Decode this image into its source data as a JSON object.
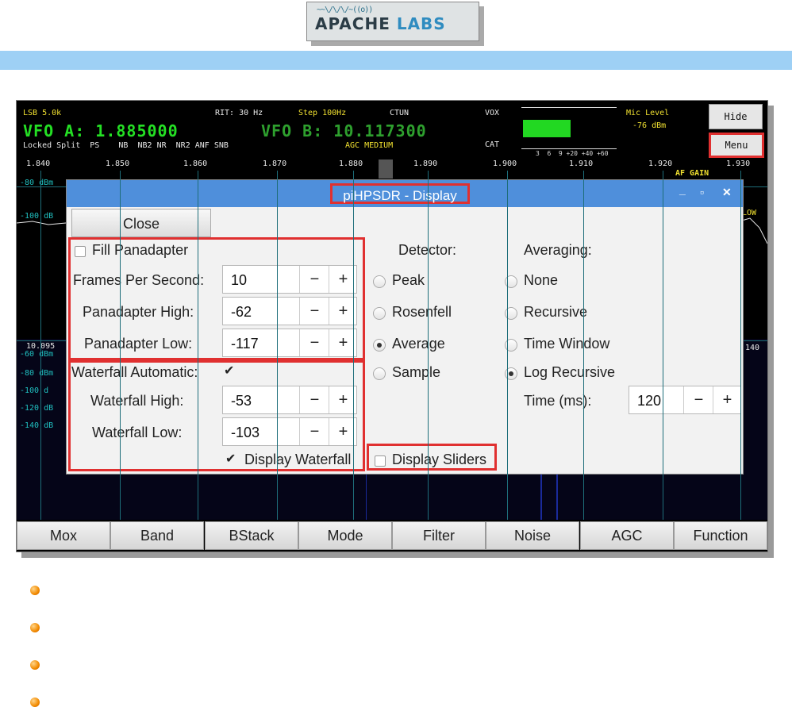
{
  "logo": {
    "wave": "~~\\/\\/\\/~((o))",
    "main": "APACHE",
    "sub": "LABS"
  },
  "radio": {
    "mode": "LSB 5.0k",
    "rit": "RIT: 30 Hz",
    "step": "Step 100Hz",
    "ctun": "CTUN",
    "vox": "VOX",
    "cat": "CAT",
    "mic_label": "Mic Level",
    "mic_value": "-76 dBm",
    "vfo_a_label": "VFO A:",
    "vfo_a": "1.885000",
    "vfo_b_label": "VFO B:",
    "vfo_b": "10.117300",
    "status": "Locked Split  PS    NB  NB2 NR  NR2 ANF SNB",
    "agc": "AGC MEDIUM",
    "meter_scale": "3  6  9 +20 +40 +60",
    "freqs": [
      "1.840",
      "1.850",
      "1.860",
      "1.870",
      "1.880",
      "1.890",
      "1.900",
      "1.910",
      "1.920",
      "1.930"
    ],
    "af_gain": "AF GAIN",
    "low": "LOW",
    "db_top": [
      "-80 dBm",
      "-100 dB"
    ],
    "wf_freq_left": "10.095",
    "wf_freq_right": "140",
    "db_bottom": [
      "-60 dBm",
      "-80 dBm",
      "-100 d",
      "-120 dB",
      "-140 dB"
    ],
    "hide": "Hide",
    "menu": "Menu"
  },
  "bottom_buttons": [
    "Mox",
    "Band",
    "BStack",
    "Mode",
    "Filter",
    "Noise",
    "AGC",
    "Function"
  ],
  "dialog": {
    "title": "piHPSDR - Display",
    "close": "Close",
    "fill_panadapter": "Fill Panadapter",
    "fps_label": "Frames Per Second:",
    "fps": "10",
    "pan_high_label": "Panadapter High:",
    "pan_high": "-62",
    "pan_low_label": "Panadapter Low:",
    "pan_low": "-117",
    "wf_auto_label": "Waterfall Automatic:",
    "wf_high_label": "Waterfall High:",
    "wf_high": "-53",
    "wf_low_label": "Waterfall Low:",
    "wf_low": "-103",
    "display_waterfall": "Display Waterfall",
    "display_sliders": "Display Sliders",
    "detector_label": "Detector:",
    "detector_options": [
      "Peak",
      "Rosenfell",
      "Average",
      "Sample"
    ],
    "detector_selected": "Average",
    "averaging_label": "Averaging:",
    "averaging_options": [
      "None",
      "Recursive",
      "Time Window",
      "Log Recursive"
    ],
    "averaging_selected": "Log Recursive",
    "time_label": "Time (ms):",
    "time": "120",
    "minus": "−",
    "plus": "+",
    "check_mark": "✔",
    "minimize": "_",
    "maximize": "▫",
    "close_x": "✕"
  },
  "colors": {
    "title_bar": "#4f8fdb",
    "highlight": "#e03030",
    "header_bar": "#9ed0f5",
    "vfo": "#24e024"
  }
}
